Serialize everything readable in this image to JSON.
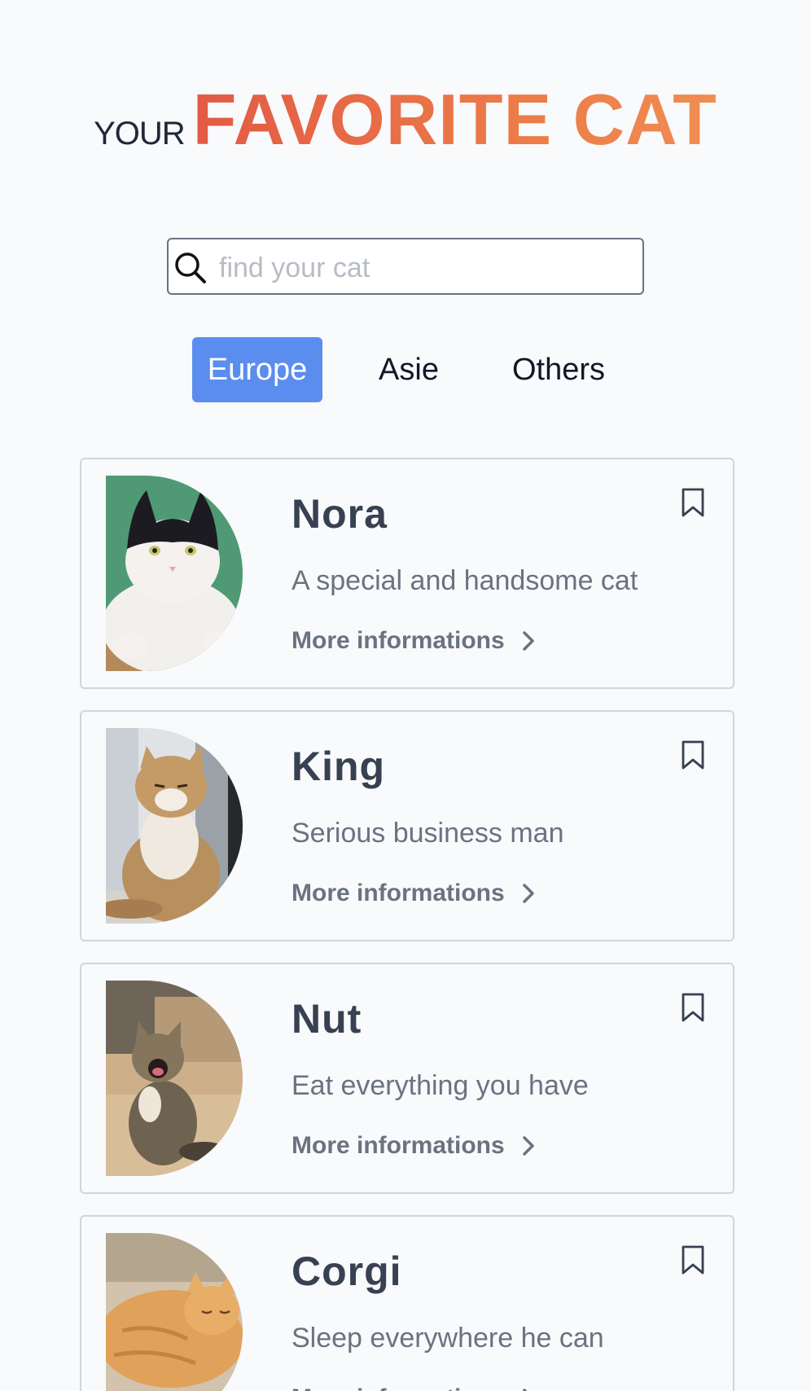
{
  "header": {
    "title_small": "YOUR",
    "title_big": "FAVORITE CAT"
  },
  "search": {
    "placeholder": "find your cat",
    "value": "",
    "icon": "search-icon"
  },
  "tabs": [
    {
      "label": "Europe",
      "active": true
    },
    {
      "label": "Asie",
      "active": false
    },
    {
      "label": "Others",
      "active": false
    }
  ],
  "colors": {
    "accent": "#5b8def",
    "title_gradient_start": "#e25a45",
    "title_gradient_end": "#ef8e52"
  },
  "cats": [
    {
      "name": "Nora",
      "description": "A special and handsome cat",
      "link": "More informations",
      "photo": "black-and-white-cat-photo"
    },
    {
      "name": "King",
      "description": "Serious business man",
      "link": "More informations",
      "photo": "fluffy-persian-cat-photo"
    },
    {
      "name": "Nut",
      "description": "Eat everything you have",
      "link": "More informations",
      "photo": "yawning-tabby-kitten-photo"
    },
    {
      "name": "Corgi",
      "description": "Sleep everywhere he can",
      "link": "More informations",
      "photo": "sleeping-orange-cat-photo"
    }
  ]
}
